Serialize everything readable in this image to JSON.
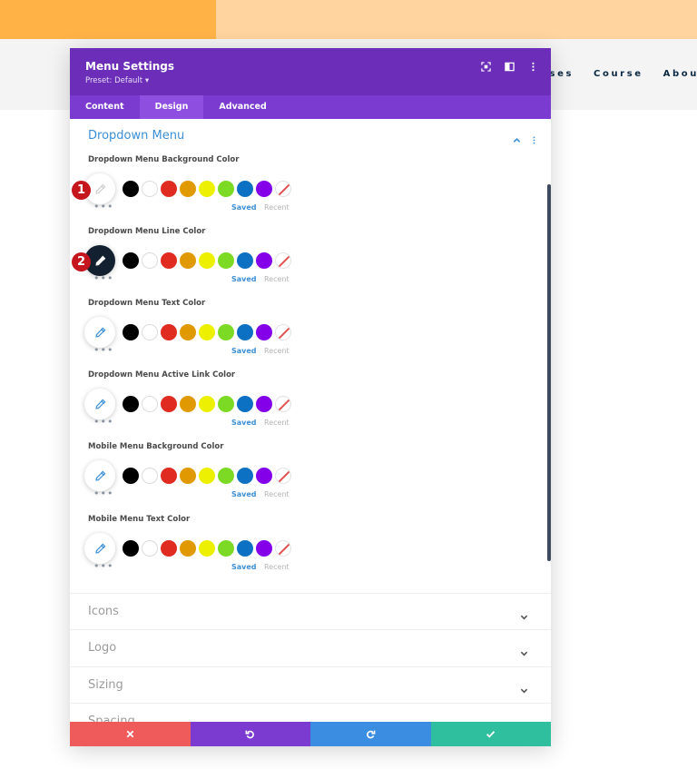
{
  "site_nav": [
    "rses",
    "Course",
    "About"
  ],
  "modal": {
    "title": "Menu Settings",
    "preset": "Preset: Default ▾",
    "header_icons": [
      "focus-icon",
      "split-view-icon",
      "more-vertical-icon"
    ]
  },
  "tabs": [
    {
      "label": "Content",
      "active": false
    },
    {
      "label": "Design",
      "active": true
    },
    {
      "label": "Advanced",
      "active": false
    }
  ],
  "section": {
    "title": "Dropdown Menu",
    "fields": [
      {
        "label": "Dropdown Menu Background Color",
        "picker_state": "light"
      },
      {
        "label": "Dropdown Menu Line Color",
        "picker_state": "dark"
      },
      {
        "label": "Dropdown Menu Text Color",
        "picker_state": "default"
      },
      {
        "label": "Dropdown Menu Active Link Color",
        "picker_state": "default"
      },
      {
        "label": "Mobile Menu Background Color",
        "picker_state": "default"
      },
      {
        "label": "Mobile Menu Text Color",
        "picker_state": "default"
      }
    ],
    "saved_label": "Saved",
    "recent_label": "Recent",
    "swatch_colors": [
      "#000000",
      "#ffffff",
      "#e02b20",
      "#e09900",
      "#edf000",
      "#7cda24",
      "#0c71c3",
      "#8300e9"
    ]
  },
  "badges": [
    "1",
    "2"
  ],
  "collapsed_sections": [
    "Icons",
    "Logo",
    "Sizing",
    "Spacing"
  ],
  "colors": {
    "accent_purple": "#6c2eb9",
    "tab_bar": "#7b3ad0",
    "link_blue": "#3c8fd6",
    "badge_red": "#c4161c",
    "footer_cancel": "#ef5a5a",
    "footer_undo": "#7b3ad0",
    "footer_redo": "#3a8de0",
    "footer_save": "#2fbf9f"
  }
}
